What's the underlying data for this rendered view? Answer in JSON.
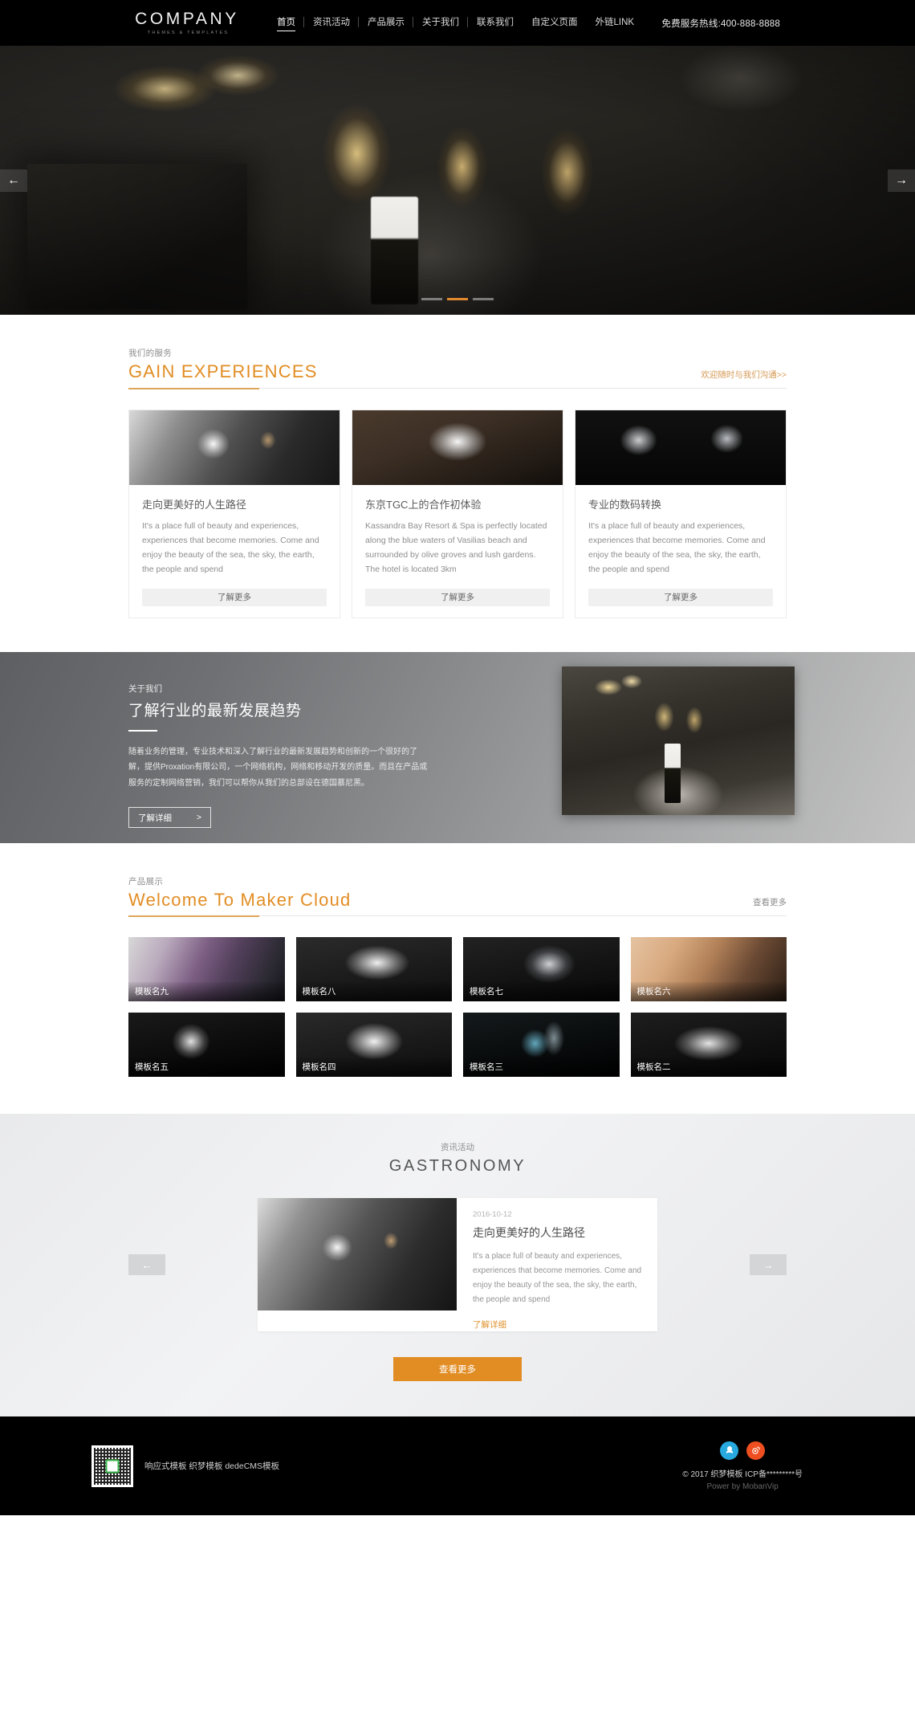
{
  "header": {
    "logo_main": "COMPANY",
    "logo_sub": "THEMES & TEMPLATES",
    "nav": [
      {
        "label": "首页",
        "active": true
      },
      {
        "label": "资讯活动",
        "active": false
      },
      {
        "label": "产品展示",
        "active": false
      },
      {
        "label": "关于我们",
        "active": false
      },
      {
        "label": "联系我们",
        "active": false
      },
      {
        "label": "自定义页面",
        "active": false
      },
      {
        "label": "外链LINK",
        "active": false
      }
    ],
    "hotline": "免费服务热线:400-888-8888"
  },
  "hero": {
    "prev_icon": "←",
    "next_icon": "→",
    "slides": 3,
    "active_slide": 2
  },
  "services": {
    "eyebrow": "我们的服务",
    "title_en": "GAIN EXPERIENCES",
    "more": "欢迎随时与我们沟通>>",
    "cards": [
      {
        "title": "走向更美好的人生路径",
        "desc": "It's a place full of beauty and experiences, experiences that become memories. Come and enjoy the beauty of the sea, the sky, the earth, the people and spend",
        "button": "了解更多"
      },
      {
        "title": "东京TGC上的合作初体验",
        "desc": "Kassandra Bay Resort & Spa is perfectly located along the blue waters of Vasilias beach and surrounded by olive groves and lush gardens. The hotel is located 3km",
        "button": "了解更多"
      },
      {
        "title": "专业的数码转换",
        "desc": "It's a place full of beauty and experiences, experiences that become memories. Come and enjoy the beauty of the sea, the sky, the earth, the people and spend",
        "button": "了解更多"
      }
    ]
  },
  "about": {
    "eyebrow": "关于我们",
    "title": "了解行业的最新发展趋势",
    "desc": "随着业务的管理，专业技术和深入了解行业的最新发展趋势和创新的一个很好的了解，提供Proxation有限公司，一个网络机构，网络和移动开发的质量。而且在产品或服务的定制网络营销，我们可以帮你从我们的总部设在德国慕尼黑。",
    "button": "了解详细",
    "button_arrow": ">"
  },
  "products": {
    "eyebrow": "产品展示",
    "title_en": "Welcome To Maker Cloud",
    "more": "查看更多",
    "items": [
      {
        "label": "模板名九"
      },
      {
        "label": "模板名八"
      },
      {
        "label": "模板名七"
      },
      {
        "label": "模板名六"
      },
      {
        "label": "模板名五"
      },
      {
        "label": "模板名四"
      },
      {
        "label": "模板名三"
      },
      {
        "label": "模板名二"
      }
    ]
  },
  "news": {
    "eyebrow": "资讯活动",
    "title_en": "GASTRONOMY",
    "prev_icon": "←",
    "next_icon": "→",
    "item": {
      "date": "2016-10-12",
      "title": "走向更美好的人生路径",
      "desc": "It's a place full of beauty and experiences, experiences that become memories. Come and enjoy the beauty of the sea, the sky, the earth, the people and spend",
      "link": "了解详细"
    },
    "more_button": "查看更多"
  },
  "footer": {
    "qr_text": "响应式模板 织梦模板 dedeCMS模板",
    "socials": [
      {
        "name": "qq",
        "glyph": "🐧"
      },
      {
        "name": "weibo",
        "glyph": "◉"
      }
    ],
    "copyright": "© 2017 织梦模板 ICP备*********号",
    "power": "Power by MobanVip"
  },
  "colors": {
    "accent_orange": "#e28d24",
    "dark": "#000000",
    "qq_blue": "#28a9e0",
    "weibo_red": "#ef4f20"
  }
}
